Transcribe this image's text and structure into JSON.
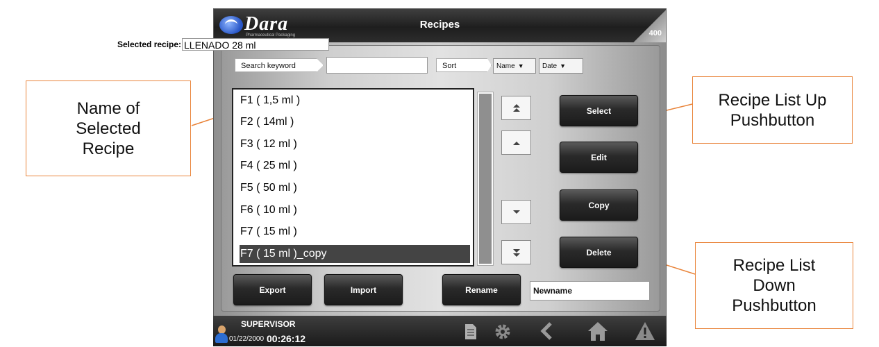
{
  "window": {
    "title": "Recipes",
    "screen_number": "400"
  },
  "logo": {
    "brand": "Dara",
    "tagline": "Pharmaceutical Packaging"
  },
  "selected": {
    "label": "Selected recipe:",
    "value": "LLENADO 28 ml"
  },
  "search": {
    "label": "Search keyword",
    "value": ""
  },
  "sort": {
    "label": "Sort",
    "name_label": "Name",
    "date_label": "Date"
  },
  "recipes": [
    "F1 ( 1,5 ml )",
    "F2 ( 14ml )",
    "F3 ( 12 ml )",
    "F4 ( 25 ml )",
    "F5 ( 50 ml )",
    "F6 ( 10 ml )",
    "F7 ( 15 ml )",
    "F7 ( 15 ml )_copy"
  ],
  "selected_index": 7,
  "buttons": {
    "select": "Select",
    "edit": "Edit",
    "copy": "Copy",
    "delete": "Delete",
    "export": "Export",
    "import": "Import",
    "rename": "Rename"
  },
  "rename_value": "Newname",
  "status": {
    "user": "SUPERVISOR",
    "date": "01/22/2000",
    "time": "00:26:12"
  },
  "icons": {
    "document": "document-icon",
    "settings": "gear-icon",
    "back": "chevron-left-icon",
    "home": "home-icon",
    "alarm": "warning-icon",
    "user": "user-icon"
  },
  "callouts": {
    "name_of_selected": [
      "Name of",
      "Selected",
      "Recipe"
    ],
    "list_up": [
      "Recipe List Up",
      "Pushbutton"
    ],
    "list_down": [
      "Recipe List",
      "Down",
      "Pushbutton"
    ]
  },
  "colors": {
    "callout_border": "#e9843a",
    "selection_bg": "#444444",
    "button_dark": "#1b1b1b"
  }
}
